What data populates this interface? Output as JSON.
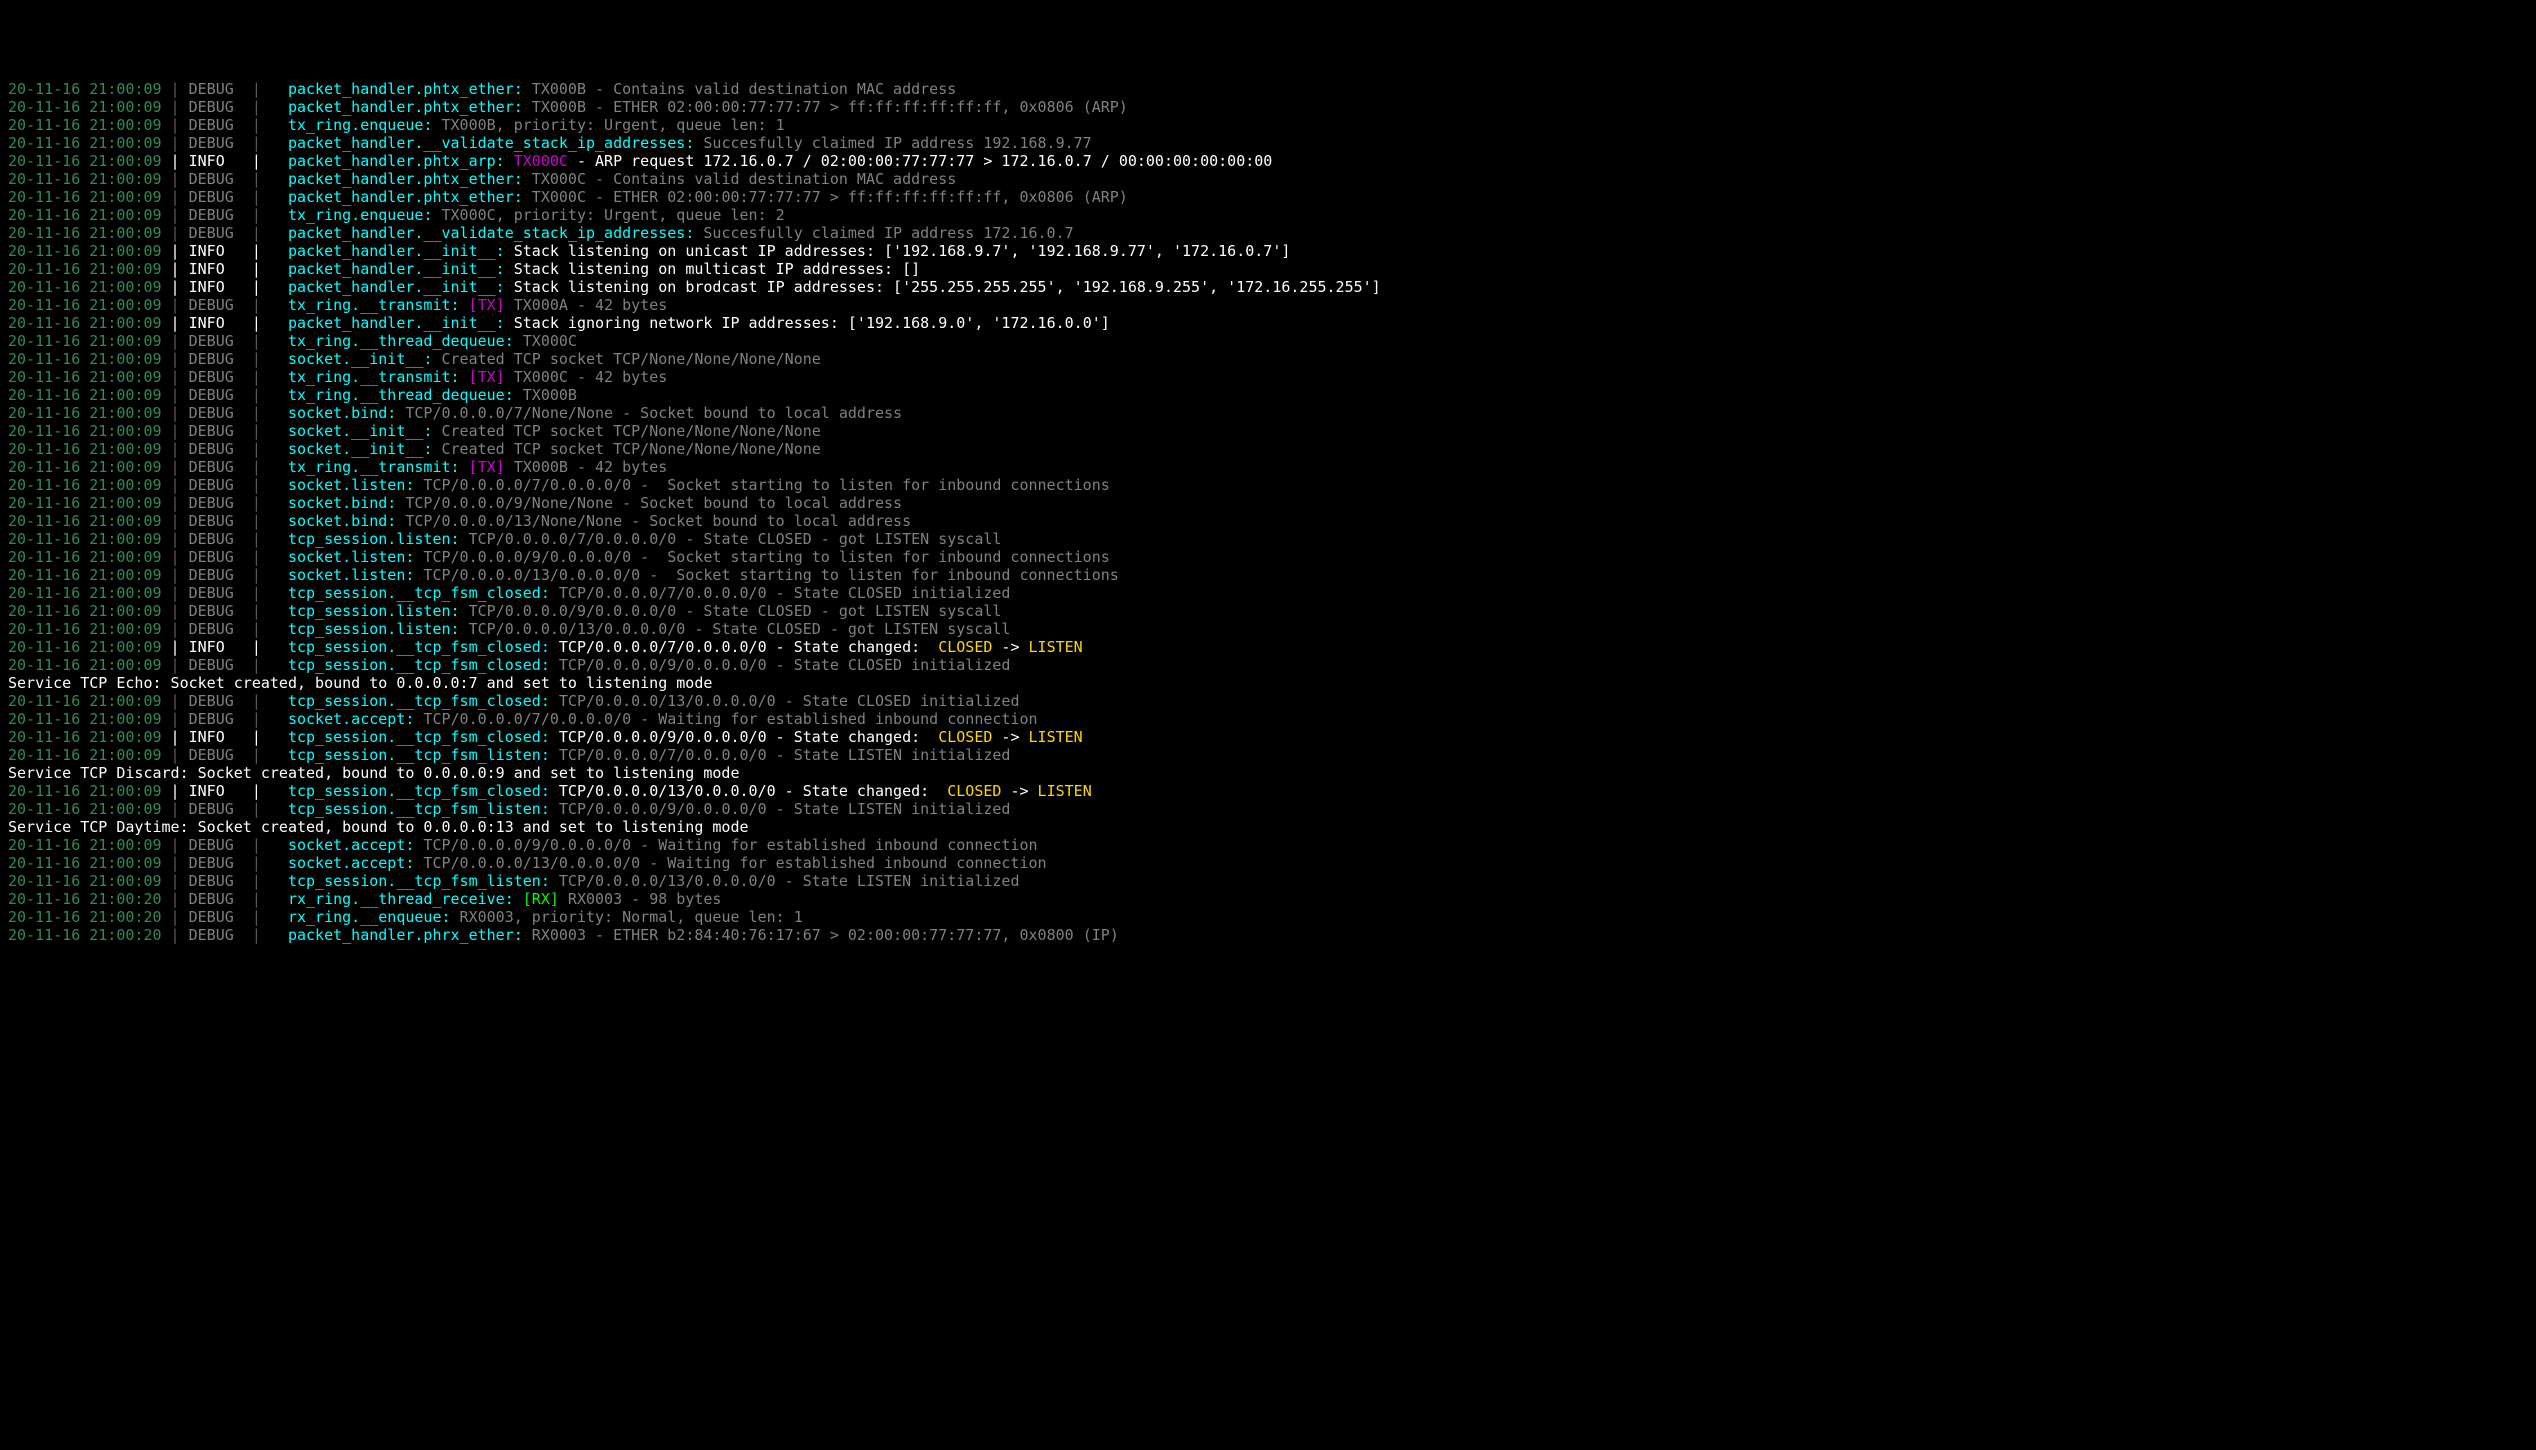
{
  "colors": {
    "ts": "#2e8b57",
    "sep_gray": "#5a5a5a",
    "sep_white": "#ffffff",
    "lvl_debug": "#808080",
    "lvl_info": "#ffffff",
    "src": "#00ffff",
    "msg_gray": "#808080",
    "msg_white": "#ffffff",
    "tx_tag": "#d000d0",
    "rx_tag": "#00ff00",
    "badge": "#ffd700",
    "plain_white": "#ffffff"
  },
  "lines": [
    {
      "type": "log",
      "ts": "20-11-16 21:00:09",
      "lvl": "DEBUG",
      "src": "packet_handler.phtx_ether:",
      "parts": [
        {
          "c": "gray",
          "t": " TX000B - Contains valid destination MAC address"
        }
      ]
    },
    {
      "type": "log",
      "ts": "20-11-16 21:00:09",
      "lvl": "DEBUG",
      "src": "packet_handler.phtx_ether:",
      "parts": [
        {
          "c": "gray",
          "t": " TX000B - ETHER 02:00:00:77:77:77 > ff:ff:ff:ff:ff:ff, 0x0806 (ARP)"
        }
      ]
    },
    {
      "type": "log",
      "ts": "20-11-16 21:00:09",
      "lvl": "DEBUG",
      "src": "tx_ring.enqueue:",
      "parts": [
        {
          "c": "gray",
          "t": " TX000B, priority: Urgent, queue len: 1"
        }
      ]
    },
    {
      "type": "log",
      "ts": "20-11-16 21:00:09",
      "lvl": "DEBUG",
      "src": "packet_handler.__validate_stack_ip_addresses:",
      "parts": [
        {
          "c": "gray",
          "t": " Succesfully claimed IP address 192.168.9.77"
        }
      ]
    },
    {
      "type": "log",
      "ts": "20-11-16 21:00:09",
      "lvl": "INFO",
      "src": "packet_handler.phtx_arp:",
      "parts": [
        {
          "c": "tx",
          "t": " TX000C"
        },
        {
          "c": "white",
          "t": " - ARP request 172.16.0.7 / 02:00:00:77:77:77 > 172.16.0.7 / 00:00:00:00:00:00"
        }
      ]
    },
    {
      "type": "log",
      "ts": "20-11-16 21:00:09",
      "lvl": "DEBUG",
      "src": "packet_handler.phtx_ether:",
      "parts": [
        {
          "c": "gray",
          "t": " TX000C - Contains valid destination MAC address"
        }
      ]
    },
    {
      "type": "log",
      "ts": "20-11-16 21:00:09",
      "lvl": "DEBUG",
      "src": "packet_handler.phtx_ether:",
      "parts": [
        {
          "c": "gray",
          "t": " TX000C - ETHER 02:00:00:77:77:77 > ff:ff:ff:ff:ff:ff, 0x0806 (ARP)"
        }
      ]
    },
    {
      "type": "log",
      "ts": "20-11-16 21:00:09",
      "lvl": "DEBUG",
      "src": "tx_ring.enqueue:",
      "parts": [
        {
          "c": "gray",
          "t": " TX000C, priority: Urgent, queue len: 2"
        }
      ]
    },
    {
      "type": "log",
      "ts": "20-11-16 21:00:09",
      "lvl": "DEBUG",
      "src": "packet_handler.__validate_stack_ip_addresses:",
      "parts": [
        {
          "c": "gray",
          "t": " Succesfully claimed IP address 172.16.0.7"
        }
      ]
    },
    {
      "type": "log",
      "ts": "20-11-16 21:00:09",
      "lvl": "INFO",
      "src": "packet_handler.__init__:",
      "parts": [
        {
          "c": "white",
          "t": " Stack listening on unicast IP addresses: ['192.168.9.7', '192.168.9.77', '172.16.0.7']"
        }
      ]
    },
    {
      "type": "log",
      "ts": "20-11-16 21:00:09",
      "lvl": "INFO",
      "src": "packet_handler.__init__:",
      "parts": [
        {
          "c": "white",
          "t": " Stack listening on multicast IP addresses: []"
        }
      ]
    },
    {
      "type": "log",
      "ts": "20-11-16 21:00:09",
      "lvl": "INFO",
      "src": "packet_handler.__init__:",
      "parts": [
        {
          "c": "white",
          "t": " Stack listening on brodcast IP addresses: ['255.255.255.255', '192.168.9.255', '172.16.255.255']"
        }
      ]
    },
    {
      "type": "log",
      "ts": "20-11-16 21:00:09",
      "lvl": "DEBUG",
      "src": "tx_ring.__transmit:",
      "parts": [
        {
          "c": "tx",
          "t": " [TX]"
        },
        {
          "c": "gray",
          "t": " TX000A - 42 bytes"
        }
      ]
    },
    {
      "type": "log",
      "ts": "20-11-16 21:00:09",
      "lvl": "INFO",
      "src": "packet_handler.__init__:",
      "parts": [
        {
          "c": "white",
          "t": " Stack ignoring network IP addresses: ['192.168.9.0', '172.16.0.0']"
        }
      ]
    },
    {
      "type": "log",
      "ts": "20-11-16 21:00:09",
      "lvl": "DEBUG",
      "src": "tx_ring.__thread_dequeue:",
      "parts": [
        {
          "c": "gray",
          "t": " TX000C"
        }
      ]
    },
    {
      "type": "log",
      "ts": "20-11-16 21:00:09",
      "lvl": "DEBUG",
      "src": "socket.__init__:",
      "parts": [
        {
          "c": "gray",
          "t": " Created TCP socket TCP/None/None/None/None"
        }
      ]
    },
    {
      "type": "log",
      "ts": "20-11-16 21:00:09",
      "lvl": "DEBUG",
      "src": "tx_ring.__transmit:",
      "parts": [
        {
          "c": "tx",
          "t": " [TX]"
        },
        {
          "c": "gray",
          "t": " TX000C - 42 bytes"
        }
      ]
    },
    {
      "type": "log",
      "ts": "20-11-16 21:00:09",
      "lvl": "DEBUG",
      "src": "tx_ring.__thread_dequeue:",
      "parts": [
        {
          "c": "gray",
          "t": " TX000B"
        }
      ]
    },
    {
      "type": "log",
      "ts": "20-11-16 21:00:09",
      "lvl": "DEBUG",
      "src": "socket.bind:",
      "parts": [
        {
          "c": "gray",
          "t": " TCP/0.0.0.0/7/None/None - Socket bound to local address"
        }
      ]
    },
    {
      "type": "log",
      "ts": "20-11-16 21:00:09",
      "lvl": "DEBUG",
      "src": "socket.__init__:",
      "parts": [
        {
          "c": "gray",
          "t": " Created TCP socket TCP/None/None/None/None"
        }
      ]
    },
    {
      "type": "log",
      "ts": "20-11-16 21:00:09",
      "lvl": "DEBUG",
      "src": "socket.__init__:",
      "parts": [
        {
          "c": "gray",
          "t": " Created TCP socket TCP/None/None/None/None"
        }
      ]
    },
    {
      "type": "log",
      "ts": "20-11-16 21:00:09",
      "lvl": "DEBUG",
      "src": "tx_ring.__transmit:",
      "parts": [
        {
          "c": "tx",
          "t": " [TX]"
        },
        {
          "c": "gray",
          "t": " TX000B - 42 bytes"
        }
      ]
    },
    {
      "type": "log",
      "ts": "20-11-16 21:00:09",
      "lvl": "DEBUG",
      "src": "socket.listen:",
      "parts": [
        {
          "c": "gray",
          "t": " TCP/0.0.0.0/7/0.0.0.0/0 -  Socket starting to listen for inbound connections"
        }
      ]
    },
    {
      "type": "log",
      "ts": "20-11-16 21:00:09",
      "lvl": "DEBUG",
      "src": "socket.bind:",
      "parts": [
        {
          "c": "gray",
          "t": " TCP/0.0.0.0/9/None/None - Socket bound to local address"
        }
      ]
    },
    {
      "type": "log",
      "ts": "20-11-16 21:00:09",
      "lvl": "DEBUG",
      "src": "socket.bind:",
      "parts": [
        {
          "c": "gray",
          "t": " TCP/0.0.0.0/13/None/None - Socket bound to local address"
        }
      ]
    },
    {
      "type": "log",
      "ts": "20-11-16 21:00:09",
      "lvl": "DEBUG",
      "src": "tcp_session.listen:",
      "parts": [
        {
          "c": "gray",
          "t": " TCP/0.0.0.0/7/0.0.0.0/0 - State CLOSED - got LISTEN syscall"
        }
      ]
    },
    {
      "type": "log",
      "ts": "20-11-16 21:00:09",
      "lvl": "DEBUG",
      "src": "socket.listen:",
      "parts": [
        {
          "c": "gray",
          "t": " TCP/0.0.0.0/9/0.0.0.0/0 -  Socket starting to listen for inbound connections"
        }
      ]
    },
    {
      "type": "log",
      "ts": "20-11-16 21:00:09",
      "lvl": "DEBUG",
      "src": "socket.listen:",
      "parts": [
        {
          "c": "gray",
          "t": " TCP/0.0.0.0/13/0.0.0.0/0 -  Socket starting to listen for inbound connections"
        }
      ]
    },
    {
      "type": "log",
      "ts": "20-11-16 21:00:09",
      "lvl": "DEBUG",
      "src": "tcp_session.__tcp_fsm_closed:",
      "parts": [
        {
          "c": "gray",
          "t": " TCP/0.0.0.0/7/0.0.0.0/0 - State CLOSED initialized"
        }
      ]
    },
    {
      "type": "log",
      "ts": "20-11-16 21:00:09",
      "lvl": "DEBUG",
      "src": "tcp_session.listen:",
      "parts": [
        {
          "c": "gray",
          "t": " TCP/0.0.0.0/9/0.0.0.0/0 - State CLOSED - got LISTEN syscall"
        }
      ]
    },
    {
      "type": "log",
      "ts": "20-11-16 21:00:09",
      "lvl": "DEBUG",
      "src": "tcp_session.listen:",
      "parts": [
        {
          "c": "gray",
          "t": " TCP/0.0.0.0/13/0.0.0.0/0 - State CLOSED - got LISTEN syscall"
        }
      ]
    },
    {
      "type": "log",
      "ts": "20-11-16 21:00:09",
      "lvl": "INFO",
      "src": "tcp_session.__tcp_fsm_closed:",
      "parts": [
        {
          "c": "white",
          "t": " TCP/0.0.0.0/7/0.0.0.0/0 - State changed: "
        },
        {
          "c": "badge",
          "t": " CLOSED "
        },
        {
          "c": "white",
          "t": "-> "
        },
        {
          "c": "badge",
          "t": "LISTEN"
        }
      ]
    },
    {
      "type": "log",
      "ts": "20-11-16 21:00:09",
      "lvl": "DEBUG",
      "src": "tcp_session.__tcp_fsm_closed:",
      "parts": [
        {
          "c": "gray",
          "t": " TCP/0.0.0.0/9/0.0.0.0/0 - State CLOSED initialized"
        }
      ]
    },
    {
      "type": "plain",
      "text": "Service TCP Echo: Socket created, bound to 0.0.0.0:7 and set to listening mode"
    },
    {
      "type": "log",
      "ts": "20-11-16 21:00:09",
      "lvl": "DEBUG",
      "src": "tcp_session.__tcp_fsm_closed:",
      "parts": [
        {
          "c": "gray",
          "t": " TCP/0.0.0.0/13/0.0.0.0/0 - State CLOSED initialized"
        }
      ]
    },
    {
      "type": "log",
      "ts": "20-11-16 21:00:09",
      "lvl": "DEBUG",
      "src": "socket.accept:",
      "parts": [
        {
          "c": "gray",
          "t": " TCP/0.0.0.0/7/0.0.0.0/0 - Waiting for established inbound connection"
        }
      ]
    },
    {
      "type": "log",
      "ts": "20-11-16 21:00:09",
      "lvl": "INFO",
      "src": "tcp_session.__tcp_fsm_closed:",
      "parts": [
        {
          "c": "white",
          "t": " TCP/0.0.0.0/9/0.0.0.0/0 - State changed: "
        },
        {
          "c": "badge",
          "t": " CLOSED "
        },
        {
          "c": "white",
          "t": "-> "
        },
        {
          "c": "badge",
          "t": "LISTEN"
        }
      ]
    },
    {
      "type": "log",
      "ts": "20-11-16 21:00:09",
      "lvl": "DEBUG",
      "src": "tcp_session.__tcp_fsm_listen:",
      "parts": [
        {
          "c": "gray",
          "t": " TCP/0.0.0.0/7/0.0.0.0/0 - State LISTEN initialized"
        }
      ]
    },
    {
      "type": "plain",
      "text": "Service TCP Discard: Socket created, bound to 0.0.0.0:9 and set to listening mode"
    },
    {
      "type": "log",
      "ts": "20-11-16 21:00:09",
      "lvl": "INFO",
      "src": "tcp_session.__tcp_fsm_closed:",
      "parts": [
        {
          "c": "white",
          "t": " TCP/0.0.0.0/13/0.0.0.0/0 - State changed: "
        },
        {
          "c": "badge",
          "t": " CLOSED "
        },
        {
          "c": "white",
          "t": "-> "
        },
        {
          "c": "badge",
          "t": "LISTEN"
        }
      ]
    },
    {
      "type": "log",
      "ts": "20-11-16 21:00:09",
      "lvl": "DEBUG",
      "src": "tcp_session.__tcp_fsm_listen:",
      "parts": [
        {
          "c": "gray",
          "t": " TCP/0.0.0.0/9/0.0.0.0/0 - State LISTEN initialized"
        }
      ]
    },
    {
      "type": "plain",
      "text": "Service TCP Daytime: Socket created, bound to 0.0.0.0:13 and set to listening mode"
    },
    {
      "type": "log",
      "ts": "20-11-16 21:00:09",
      "lvl": "DEBUG",
      "src": "socket.accept:",
      "parts": [
        {
          "c": "gray",
          "t": " TCP/0.0.0.0/9/0.0.0.0/0 - Waiting for established inbound connection"
        }
      ]
    },
    {
      "type": "log",
      "ts": "20-11-16 21:00:09",
      "lvl": "DEBUG",
      "src": "socket.accept:",
      "parts": [
        {
          "c": "gray",
          "t": " TCP/0.0.0.0/13/0.0.0.0/0 - Waiting for established inbound connection"
        }
      ]
    },
    {
      "type": "log",
      "ts": "20-11-16 21:00:09",
      "lvl": "DEBUG",
      "src": "tcp_session.__tcp_fsm_listen:",
      "parts": [
        {
          "c": "gray",
          "t": " TCP/0.0.0.0/13/0.0.0.0/0 - State LISTEN initialized"
        }
      ]
    },
    {
      "type": "log",
      "ts": "20-11-16 21:00:20",
      "lvl": "DEBUG",
      "src": "rx_ring.__thread_receive:",
      "parts": [
        {
          "c": "rx",
          "t": " [RX]"
        },
        {
          "c": "gray",
          "t": " RX0003 - 98 bytes"
        }
      ]
    },
    {
      "type": "log",
      "ts": "20-11-16 21:00:20",
      "lvl": "DEBUG",
      "src": "rx_ring.__enqueue:",
      "parts": [
        {
          "c": "gray",
          "t": " RX0003, priority: Normal, queue len: 1"
        }
      ]
    },
    {
      "type": "log",
      "ts": "20-11-16 21:00:20",
      "lvl": "DEBUG",
      "src": "packet_handler.phrx_ether:",
      "parts": [
        {
          "c": "gray",
          "t": " RX0003 - ETHER b2:84:40:76:17:67 > 02:00:00:77:77:77, 0x0800 (IP)"
        }
      ]
    }
  ]
}
